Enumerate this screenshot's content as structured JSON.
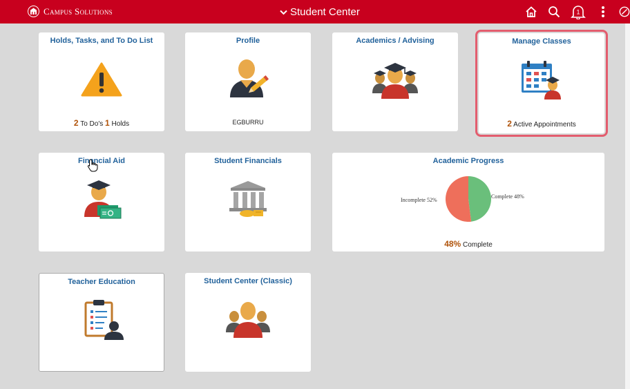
{
  "header": {
    "brand": "Campus Solutions",
    "title": "Student Center",
    "notification_count": "1",
    "accent_color": "#c8001e"
  },
  "tiles": {
    "holds": {
      "title": "Holds, Tasks, and To Do List",
      "todo_count": "2",
      "todo_label": "To Do's",
      "holds_count": "1",
      "holds_label": "Holds",
      "icon": "warning-icon"
    },
    "profile": {
      "title": "Profile",
      "username": "EGBURRU",
      "icon": "profile-edit-icon"
    },
    "academics": {
      "title": "Academics / Advising",
      "icon": "graduates-icon"
    },
    "manage_classes": {
      "title": "Manage Classes",
      "appt_count": "2",
      "appt_label": "Active Appointments",
      "icon": "calendar-student-icon"
    },
    "financial_aid": {
      "title": "Financial Aid",
      "icon": "graduate-money-icon"
    },
    "student_financials": {
      "title": "Student Financials",
      "icon": "bank-icon"
    },
    "academic_progress": {
      "title": "Academic Progress",
      "percent": "48%",
      "percent_label": "Complete"
    },
    "teacher_education": {
      "title": "Teacher Education",
      "icon": "clipboard-person-icon"
    },
    "student_center_classic": {
      "title": "Student Center (Classic)",
      "icon": "group-icon"
    }
  },
  "chart_data": {
    "type": "pie",
    "categories": [
      "Complete",
      "Incomplete"
    ],
    "values": [
      48,
      52
    ],
    "labels": [
      "Complete 48%",
      "Incomplete 52%"
    ],
    "colors": [
      "#6abf7b",
      "#ee6f5b"
    ]
  }
}
